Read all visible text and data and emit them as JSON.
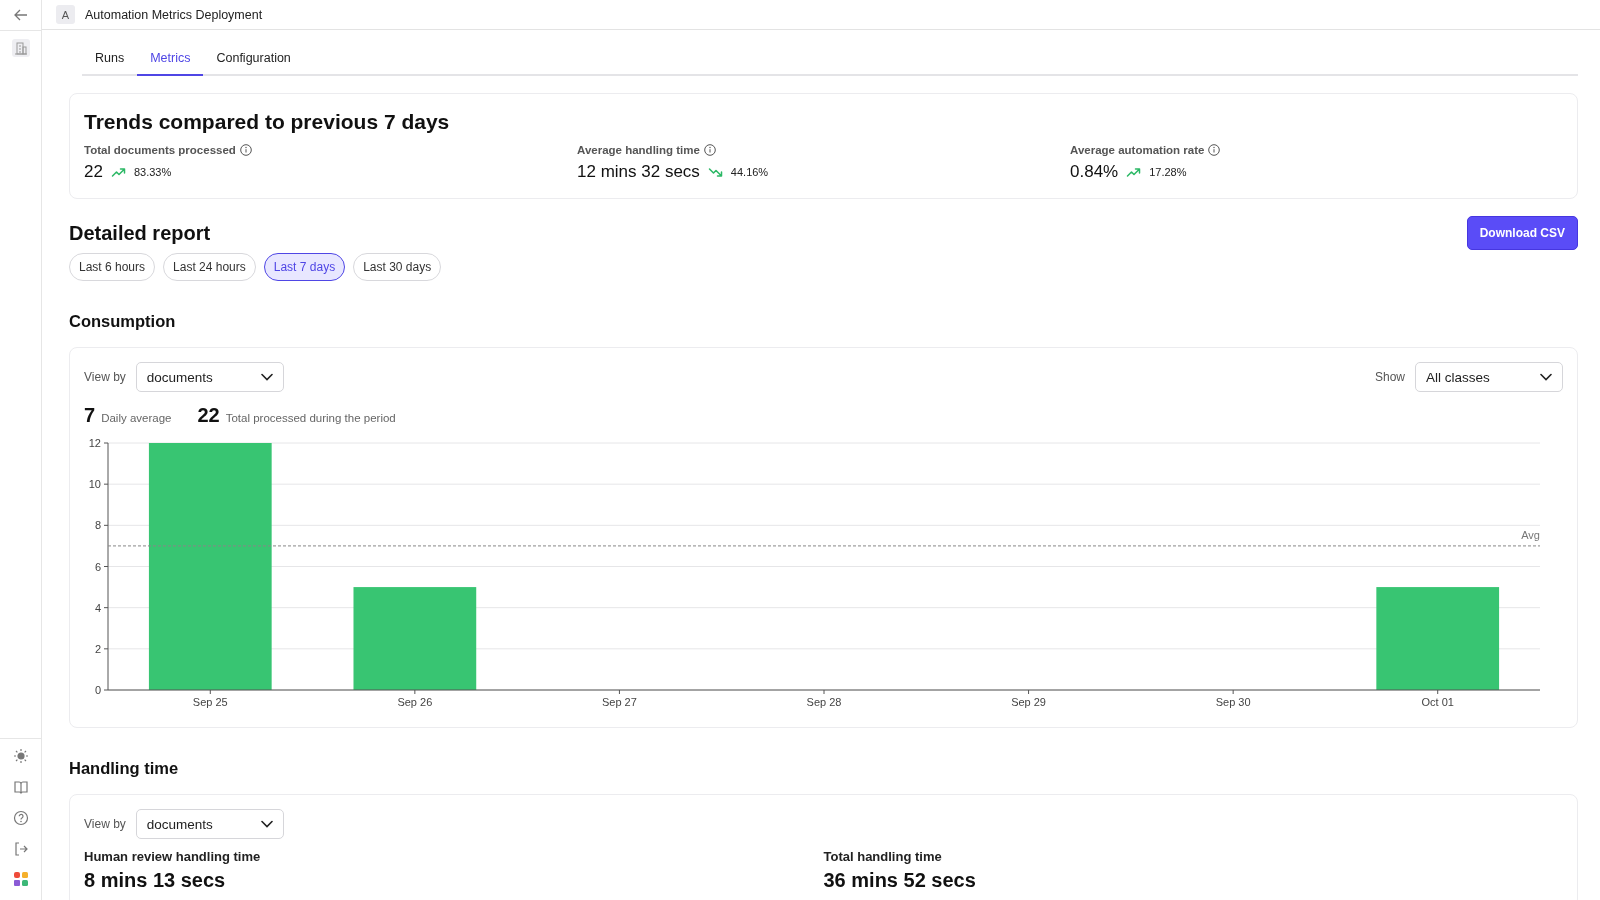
{
  "header": {
    "avatar_letter": "A",
    "title": "Automation Metrics Deployment"
  },
  "tabs": [
    {
      "label": "Runs",
      "selected": false
    },
    {
      "label": "Metrics",
      "selected": true
    },
    {
      "label": "Configuration",
      "selected": false
    }
  ],
  "trends": {
    "title": "Trends compared to previous 7 days",
    "metrics": [
      {
        "label": "Total documents processed",
        "value": "22",
        "kind": "up",
        "change": "83.33%"
      },
      {
        "label": "Average handling time",
        "value": "12 mins 32 secs",
        "kind": "down",
        "change": "44.16%"
      },
      {
        "label": "Average automation rate",
        "value": "0.84%",
        "kind": "up",
        "change": "17.28%"
      }
    ]
  },
  "report": {
    "title": "Detailed report",
    "download_button": "Download CSV",
    "ranges": [
      {
        "label": "Last 6 hours",
        "selected": false
      },
      {
        "label": "Last 24 hours",
        "selected": false
      },
      {
        "label": "Last 7 days",
        "selected": true
      },
      {
        "label": "Last 30 days",
        "selected": false
      }
    ]
  },
  "consumption": {
    "title": "Consumption",
    "view_by_label": "View by",
    "view_by_value": "documents",
    "show_label": "Show",
    "show_value": "All classes",
    "stats": [
      {
        "value": "7",
        "label": "Daily average"
      },
      {
        "value": "22",
        "label": "Total processed during the period"
      }
    ],
    "chart_data": {
      "type": "bar",
      "categories": [
        "Sep 25",
        "Sep 26",
        "Sep 27",
        "Sep 28",
        "Sep 29",
        "Sep 30",
        "Oct 01"
      ],
      "series": [
        {
          "color": "#38c572",
          "values": [
            12,
            5,
            0,
            0,
            0,
            0,
            5
          ]
        }
      ],
      "ylim": [
        0,
        12
      ],
      "yticks": [
        0,
        2,
        4,
        6,
        8,
        10,
        12
      ],
      "grid": true,
      "ref_lines": [
        {
          "axis": "y",
          "value": 7,
          "label": "Avg"
        }
      ]
    }
  },
  "handling_time": {
    "title": "Handling time",
    "view_by_label": "View by",
    "view_by_value": "documents",
    "metrics": [
      {
        "label": "Human review handling time",
        "value": "8 mins 13 secs"
      },
      {
        "label": "Total handling time",
        "value": "36 mins 52 secs"
      }
    ]
  }
}
